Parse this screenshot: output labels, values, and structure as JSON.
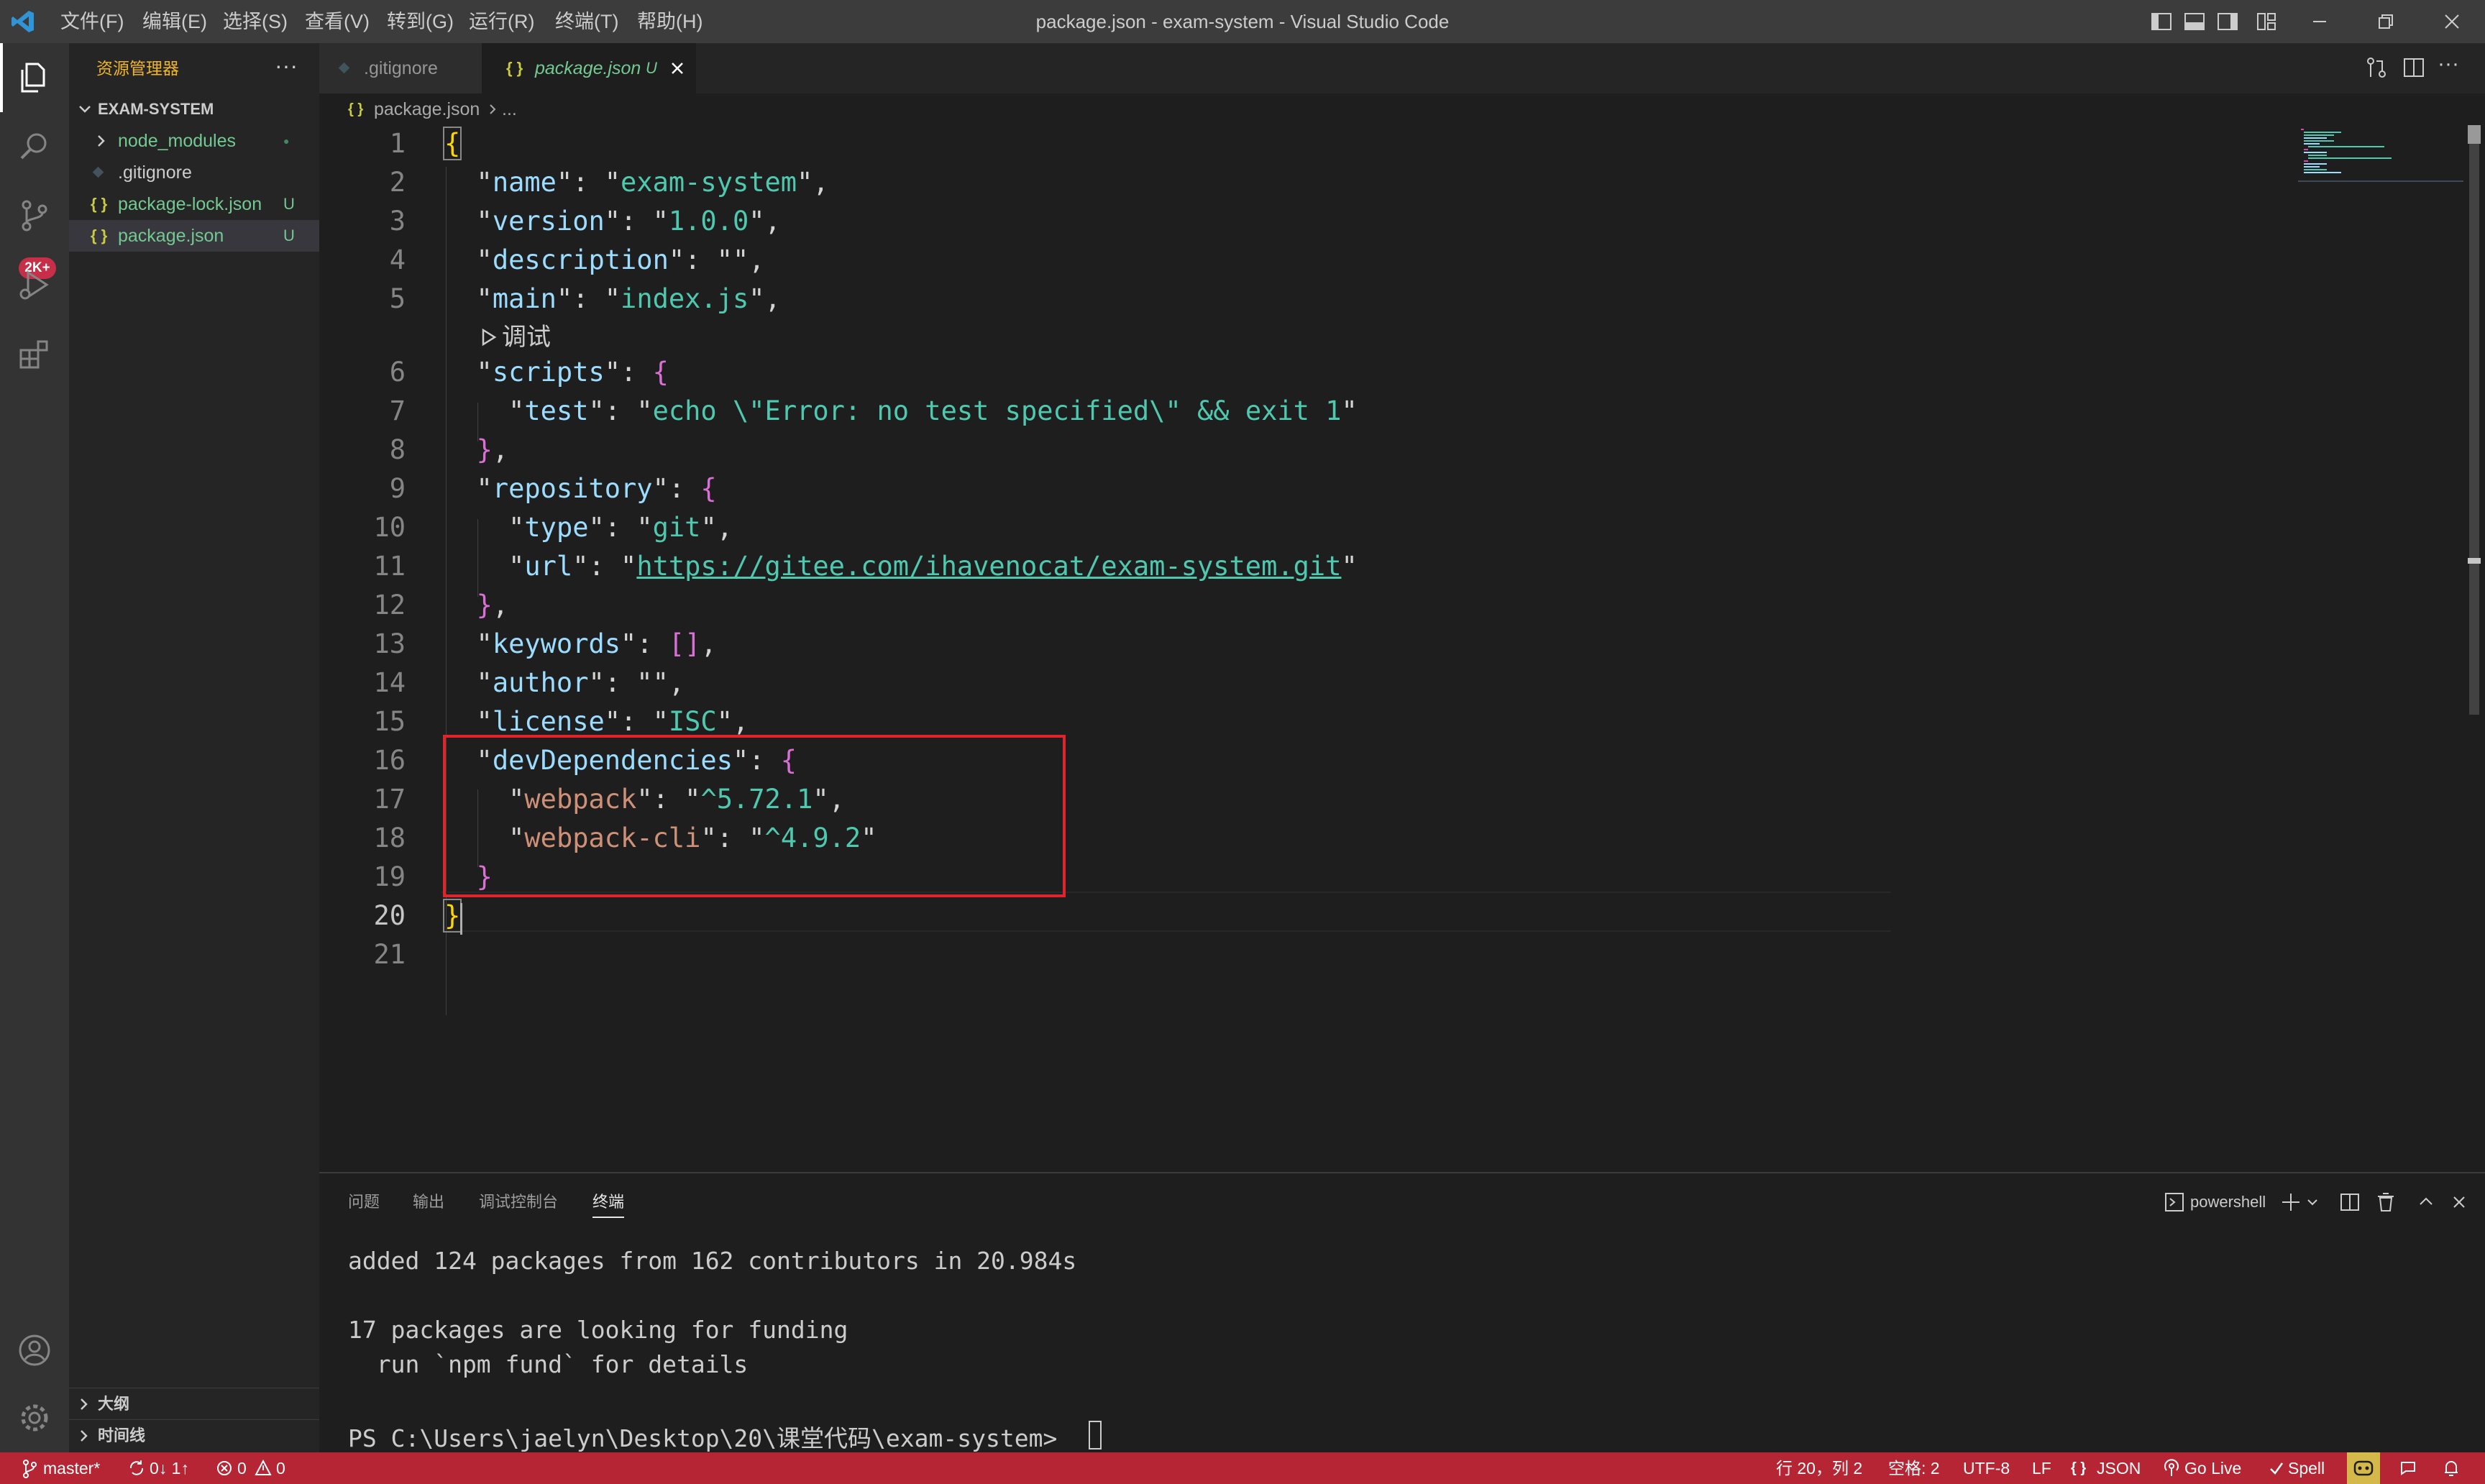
{
  "titlebar": {
    "menu": [
      "文件(F)",
      "编辑(E)",
      "选择(S)",
      "查看(V)",
      "转到(G)",
      "运行(R)",
      "终端(T)",
      "帮助(H)"
    ],
    "title": "package.json - exam-system - Visual Studio Code"
  },
  "activitybar": {
    "scm_badge": "2K+"
  },
  "sidebar": {
    "title": "资源管理器",
    "more": "···",
    "folder": "EXAM-SYSTEM",
    "items": [
      {
        "label": "node_modules",
        "status": "●"
      },
      {
        "label": ".gitignore",
        "status": ""
      },
      {
        "label": "package-lock.json",
        "status": "U"
      },
      {
        "label": "package.json",
        "status": "U"
      }
    ],
    "outline": "大纲",
    "timeline": "时间线"
  },
  "tabs": [
    {
      "label": ".gitignore",
      "active": false
    },
    {
      "label": "package.json",
      "status": "U",
      "active": true
    }
  ],
  "breadcrumb": {
    "file": "package.json",
    "rest": "..."
  },
  "editor": {
    "codelens": "调试",
    "line_numbers": [
      "1",
      "2",
      "3",
      "4",
      "5",
      "6",
      "7",
      "8",
      "9",
      "10",
      "11",
      "12",
      "13",
      "14",
      "15",
      "16",
      "17",
      "18",
      "19",
      "20",
      "21"
    ],
    "json": {
      "name_key": "name",
      "name_val": "exam-system",
      "version_key": "version",
      "version_val": "1.0.0",
      "description_key": "description",
      "main_key": "main",
      "main_val": "index.js",
      "scripts_key": "scripts",
      "test_key": "test",
      "test_val": "echo \\\"Error: no test specified\\\" && exit 1",
      "repository_key": "repository",
      "type_key": "type",
      "type_val": "git",
      "url_key": "url",
      "url_val": "https://gitee.com/ihavenocat/exam-system.git",
      "keywords_key": "keywords",
      "author_key": "author",
      "license_key": "license",
      "license_val": "ISC",
      "devdeps_key": "devDependencies",
      "webpack_key": "webpack",
      "webpack_val": "^5.72.1",
      "webpackcli_key": "webpack-cli",
      "webpackcli_val": "^4.9.2"
    }
  },
  "panel": {
    "tabs": [
      "问题",
      "输出",
      "调试控制台",
      "终端"
    ],
    "shell": "powershell",
    "lines": [
      "added 124 packages from 162 contributors in 20.984s",
      "17 packages are looking for funding",
      "  run `npm fund` for details",
      "PS C:\\Users\\jaelyn\\Desktop\\20\\课堂代码\\exam-system> "
    ]
  },
  "statusbar": {
    "branch": "master*",
    "sync": "0↓ 1↑",
    "errors": "0",
    "warnings": "0",
    "position": "行 20，列 2",
    "spaces": "空格: 2",
    "encoding": "UTF-8",
    "eol": "LF",
    "language": "JSON",
    "golive": "Go Live",
    "spell": "Spell"
  },
  "colors": {
    "statusbar": "#b52533",
    "highlight": "#e0242c",
    "accent": "#f0b429"
  }
}
